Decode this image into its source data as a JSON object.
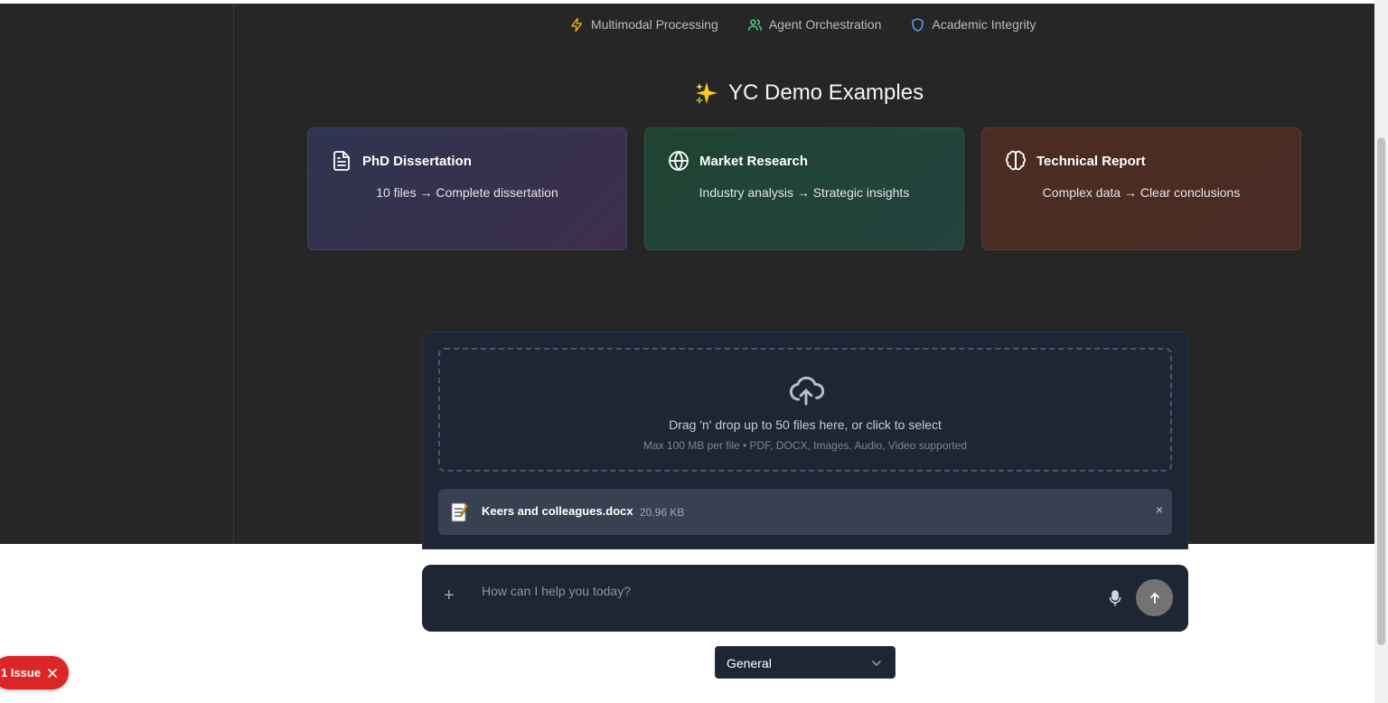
{
  "features": [
    {
      "label": "Multimodal Processing",
      "icon": "lightning-icon",
      "color": "#eab308"
    },
    {
      "label": "Agent Orchestration",
      "icon": "users-icon",
      "color": "#4ade80"
    },
    {
      "label": "Academic Integrity",
      "icon": "shield-icon",
      "color": "#60a5fa"
    }
  ],
  "demo": {
    "title": "YC Demo Examples",
    "icon": "sparkles-icon",
    "cards": [
      {
        "title": "PhD Dissertation",
        "description": "10 files → Complete dissertation",
        "icon": "document-icon"
      },
      {
        "title": "Market Research",
        "description": "Industry analysis → Strategic insights",
        "icon": "globe-icon"
      },
      {
        "title": "Technical Report",
        "description": "Complex data → Clear conclusions",
        "icon": "brain-icon"
      }
    ]
  },
  "upload": {
    "primary_text": "Drag 'n' drop up to 50 files here, or click to select",
    "secondary_text": "Max 100 MB per file • PDF, DOCX, Images, Audio, Video supported",
    "files": [
      {
        "name": "Keers and colleagues.docx",
        "size": "20.96 KB"
      }
    ],
    "remove_symbol": "×"
  },
  "chat": {
    "placeholder": "How can I help you today?",
    "add_symbol": "+"
  },
  "mode_select": {
    "value": "General"
  },
  "issues_badge": {
    "label": "1 Issue"
  }
}
